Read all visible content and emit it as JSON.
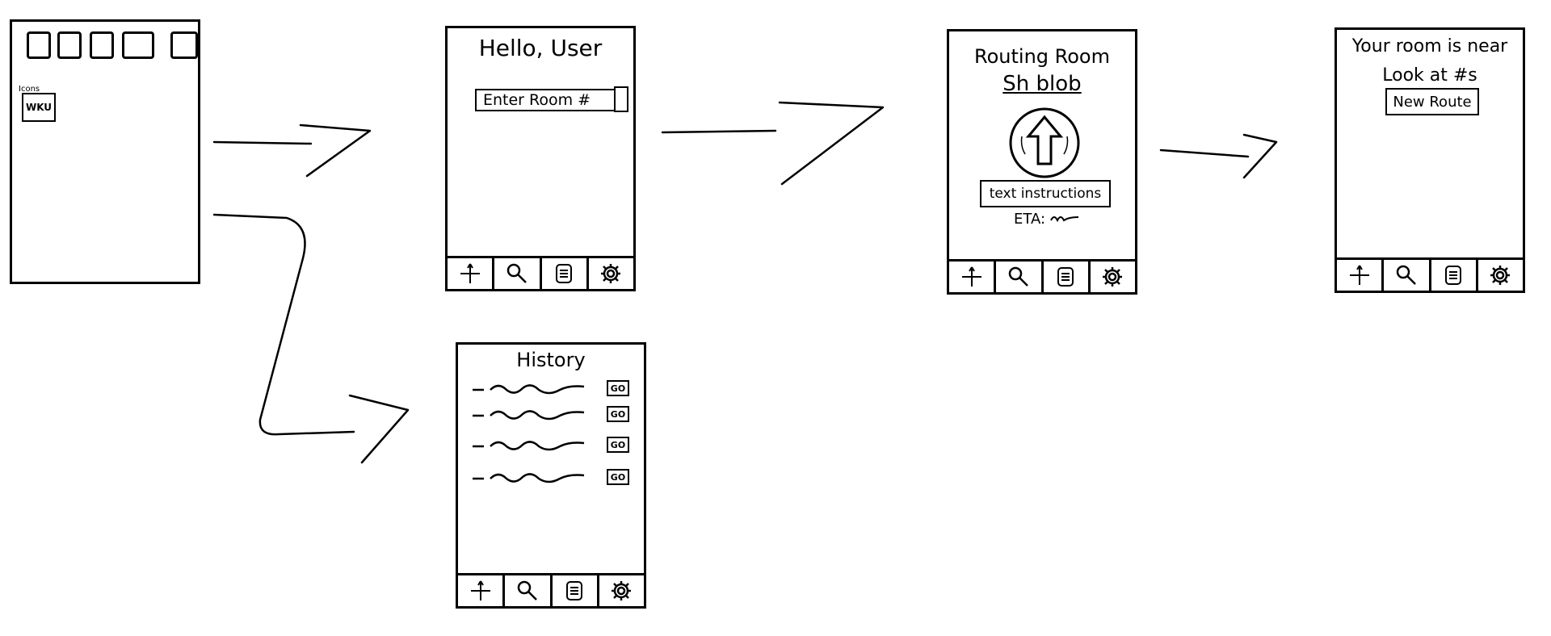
{
  "home": {
    "tile_label_top": "Icons",
    "tile_label": "WKU"
  },
  "screen_hello": {
    "title": "Hello, User",
    "room_input_placeholder": "Enter Room #"
  },
  "screen_routing": {
    "title_line1": "Routing Room",
    "title_line2": "Sh blob",
    "instructions": "text instructions",
    "eta": "ETA:"
  },
  "screen_near": {
    "title_line1": "Your room is near",
    "title_line2": "Look at #s",
    "new_route_button": "New Route"
  },
  "screen_history": {
    "title": "History",
    "row_button": "GO",
    "rows": 4
  },
  "tabbar": {
    "icons": [
      "compass-icon",
      "search-icon",
      "notes-icon",
      "settings-gear-icon"
    ]
  }
}
